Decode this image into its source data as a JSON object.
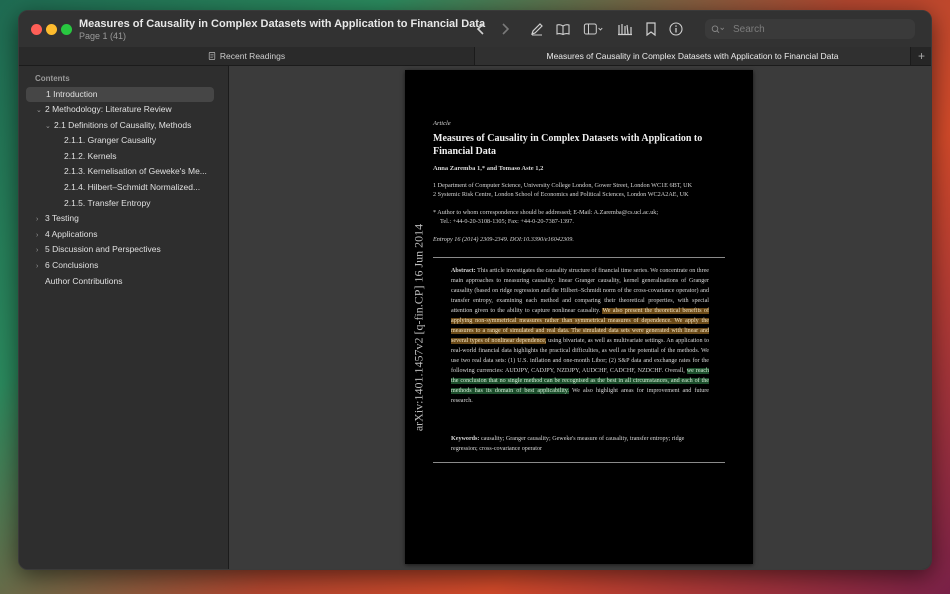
{
  "window": {
    "title": "Measures of Causality in Complex Datasets with Application to Financial Data",
    "subtitle": "Page 1 (41)"
  },
  "toolbar": {
    "search_placeholder": "Search",
    "icons": [
      "chevron-left-icon",
      "chevron-right-icon",
      "pencil-icon",
      "book-icon",
      "sidebar-icon",
      "library-icon",
      "bookmark-icon",
      "info-icon",
      "search-icon"
    ]
  },
  "tabs": {
    "left_label": "Recent Readings",
    "right_label": "Measures of Causality in Complex Datasets with Application to Financial Data",
    "plus": "+"
  },
  "sidebar": {
    "header": "Contents",
    "items": [
      {
        "label": "1 Introduction",
        "chevron": "",
        "selected": true
      },
      {
        "label": "2 Methodology: Literature Review",
        "chevron": "⌄"
      },
      {
        "label": "2.1 Definitions of Causality, Methods",
        "chevron": "⌄"
      },
      {
        "label": "2.1.1.  Granger Causality",
        "chevron": ""
      },
      {
        "label": "2.1.2.  Kernels",
        "chevron": ""
      },
      {
        "label": "2.1.3.  Kernelisation of Geweke's Me...",
        "chevron": ""
      },
      {
        "label": "2.1.4.  Hilbert–Schmidt Normalized...",
        "chevron": ""
      },
      {
        "label": "2.1.5.  Transfer Entropy",
        "chevron": ""
      },
      {
        "label": "3 Testing",
        "chevron": "›"
      },
      {
        "label": "4 Applications",
        "chevron": "›"
      },
      {
        "label": "5 Discussion and Perspectives",
        "chevron": "›"
      },
      {
        "label": "6 Conclusions",
        "chevron": "›"
      },
      {
        "label": "Author Contributions",
        "chevron": ""
      }
    ]
  },
  "document": {
    "arxiv_id": "arXiv:1401.1457v2  [q-fin.CP]  16 Jun 2014",
    "article_label": "Article",
    "title": "Measures of Causality in Complex Datasets with Application to Financial Data",
    "authors": "Anna Zaremba 1,* and Tomaso Aste 1,2",
    "affiliation_1": "1 Department of Computer Science, University College London, Gower Street, London WC1E 6BT, UK",
    "affiliation_2": "2 Systemic Risk Centre, London School of Economics and Political Sciences, London WC2A2AE, UK",
    "correspondence_1": "* Author to whom correspondence should be addressed; E-Mail: A.Zaremba@cs.ucl.ac.uk;",
    "correspondence_2": "Tel.: +44-0-20-3108-1305; Fax: +44-0-20-7387-1397.",
    "journal": "Entropy 16 (2014) 2309-2349. DOI:10.3390/e16042309.",
    "abstract_label": "Abstract:",
    "abstract_part1": " This article investigates the causality structure of financial time series. We concentrate on three main approaches to measuring causality: linear Granger causality, kernel generalisations of Granger causality (based on ridge regression and the Hilbert–Schmidt norm of the cross-covariance operator) and transfer entropy, examining each method and comparing their theoretical properties, with special attention given to the ability to capture nonlinear causality. ",
    "abstract_highlight_orange": "We also present the theoretical benefits of applying non-symmetrical measures rather than symmetrical measures of dependence. We apply the measures to a range of simulated and real data. The simulated data sets were generated with linear and several types of nonlinear dependence,",
    "abstract_part2": " using bivariate, as well as multivariate settings. An application to real-world financial data highlights the practical difficulties, as well as the potential of the methods. We use two real data sets: (1) U.S. inflation and one-month Libor; (2) S&P data and exchange rates for the following currencies: AUDJPY, CADJPY, NZDJPY, AUDCHF, CADCHF, NZDCHF. Overall, ",
    "abstract_highlight_green": "we reach the conclusion that no single method can be recognised as the best in all circumstances, and each of the methods has its domain of best applicability.",
    "abstract_part3": " We also highlight areas for improvement and future research.",
    "keywords_label": "Keywords:",
    "keywords": " causality; Granger causality; Geweke's measure of causality, transfer entropy; ridge regression; cross-covariance operator"
  }
}
